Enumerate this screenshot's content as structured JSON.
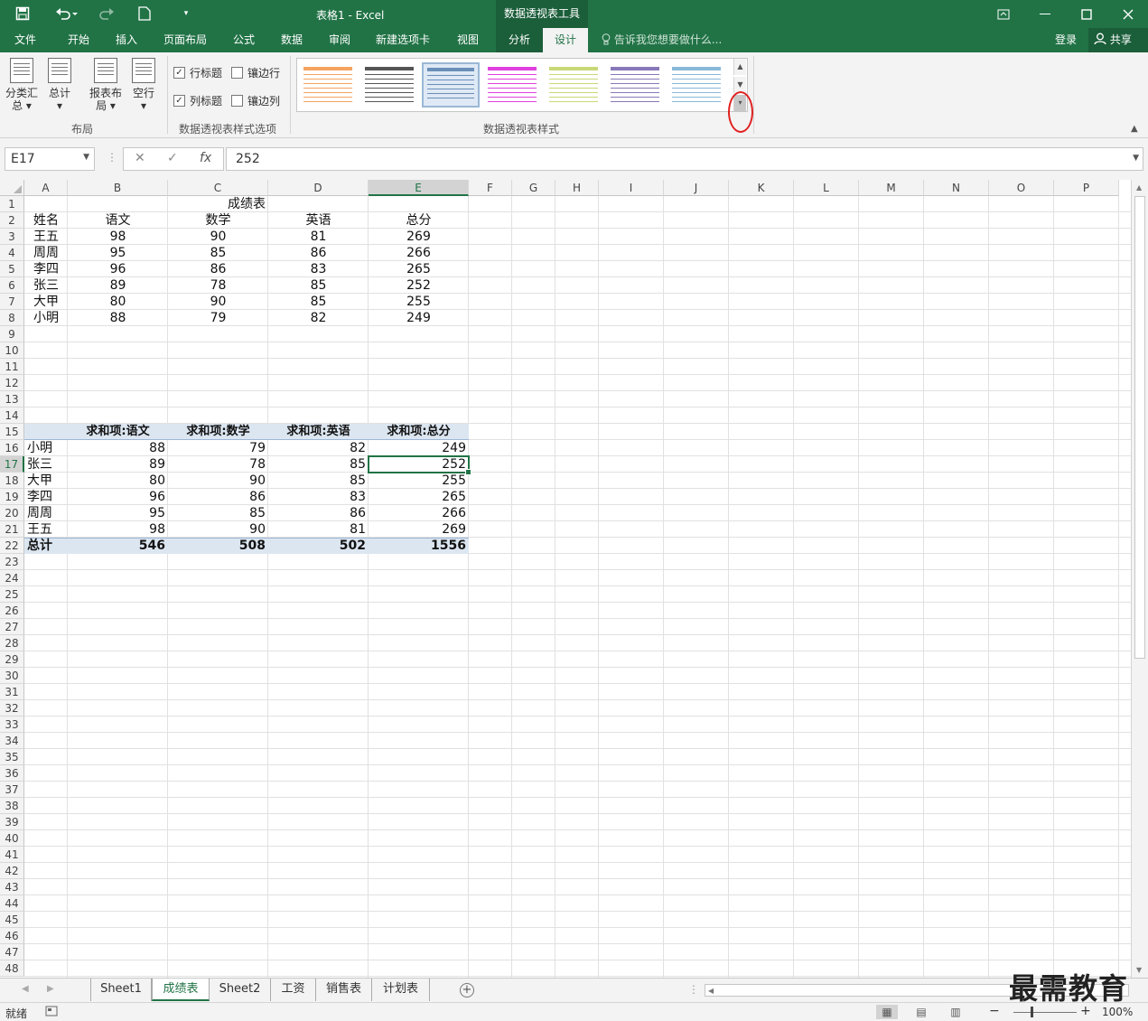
{
  "window": {
    "title": "表格1 - Excel",
    "context_tool": "数据透视表工具",
    "quick_access": [
      "save-icon",
      "undo-icon",
      "redo-icon",
      "new-file-icon",
      "customize-icon"
    ]
  },
  "tabs": [
    "文件",
    "开始",
    "插入",
    "页面布局",
    "公式",
    "数据",
    "审阅",
    "新建选项卡",
    "视图",
    "分析",
    "设计"
  ],
  "active_tab": "设计",
  "tell_me": "告诉我您想要做什么...",
  "sign_in": "登录",
  "share": "共享",
  "ribbon": {
    "layout_buttons": [
      "分类汇总",
      "总计",
      "报表布局",
      "空行"
    ],
    "layout_group": "布局",
    "options": {
      "row_headers": {
        "label": "行标题",
        "checked": true
      },
      "banded_rows": {
        "label": "镶边行",
        "checked": false
      },
      "col_headers": {
        "label": "列标题",
        "checked": true
      },
      "banded_cols": {
        "label": "镶边列",
        "checked": false
      }
    },
    "options_group": "数据透视表样式选项",
    "styles_group": "数据透视表样式",
    "style_colors": [
      "#f4a460",
      "#555555",
      "#6a8fb8",
      "#e040e0",
      "#c8d878",
      "#8878b8",
      "#88b8d8"
    ],
    "selected_style": 2
  },
  "formula_bar": {
    "name_box": "E17",
    "value": "252"
  },
  "columns": [
    "A",
    "B",
    "C",
    "D",
    "E",
    "F",
    "G",
    "H",
    "I",
    "J",
    "K",
    "L",
    "M",
    "N",
    "O",
    "P"
  ],
  "selected_col": "E",
  "selected_row": 17,
  "source_table": {
    "title": "成绩表",
    "headers": [
      "姓名",
      "语文",
      "数学",
      "英语",
      "总分"
    ],
    "rows": [
      [
        "王五",
        "98",
        "90",
        "81",
        "269"
      ],
      [
        "周周",
        "95",
        "85",
        "86",
        "266"
      ],
      [
        "李四",
        "96",
        "86",
        "83",
        "265"
      ],
      [
        "张三",
        "89",
        "78",
        "85",
        "252"
      ],
      [
        "大甲",
        "80",
        "90",
        "85",
        "255"
      ],
      [
        "小明",
        "88",
        "79",
        "82",
        "249"
      ]
    ]
  },
  "pivot_table": {
    "headers": [
      "",
      "求和项:语文",
      "求和项:数学",
      "求和项:英语",
      "求和项:总分"
    ],
    "rows": [
      [
        "小明",
        "88",
        "79",
        "82",
        "249"
      ],
      [
        "张三",
        "89",
        "78",
        "85",
        "252"
      ],
      [
        "大甲",
        "80",
        "90",
        "85",
        "255"
      ],
      [
        "李四",
        "96",
        "86",
        "83",
        "265"
      ],
      [
        "周周",
        "95",
        "85",
        "86",
        "266"
      ],
      [
        "王五",
        "98",
        "90",
        "81",
        "269"
      ]
    ],
    "total": [
      "总计",
      "546",
      "508",
      "502",
      "1556"
    ]
  },
  "sheets": [
    "Sheet1",
    "成绩表",
    "Sheet2",
    "工资",
    "销售表",
    "计划表"
  ],
  "active_sheet": "成绩表",
  "status": {
    "ready": "就绪",
    "zoom": "100%"
  },
  "watermark": "最需教育"
}
